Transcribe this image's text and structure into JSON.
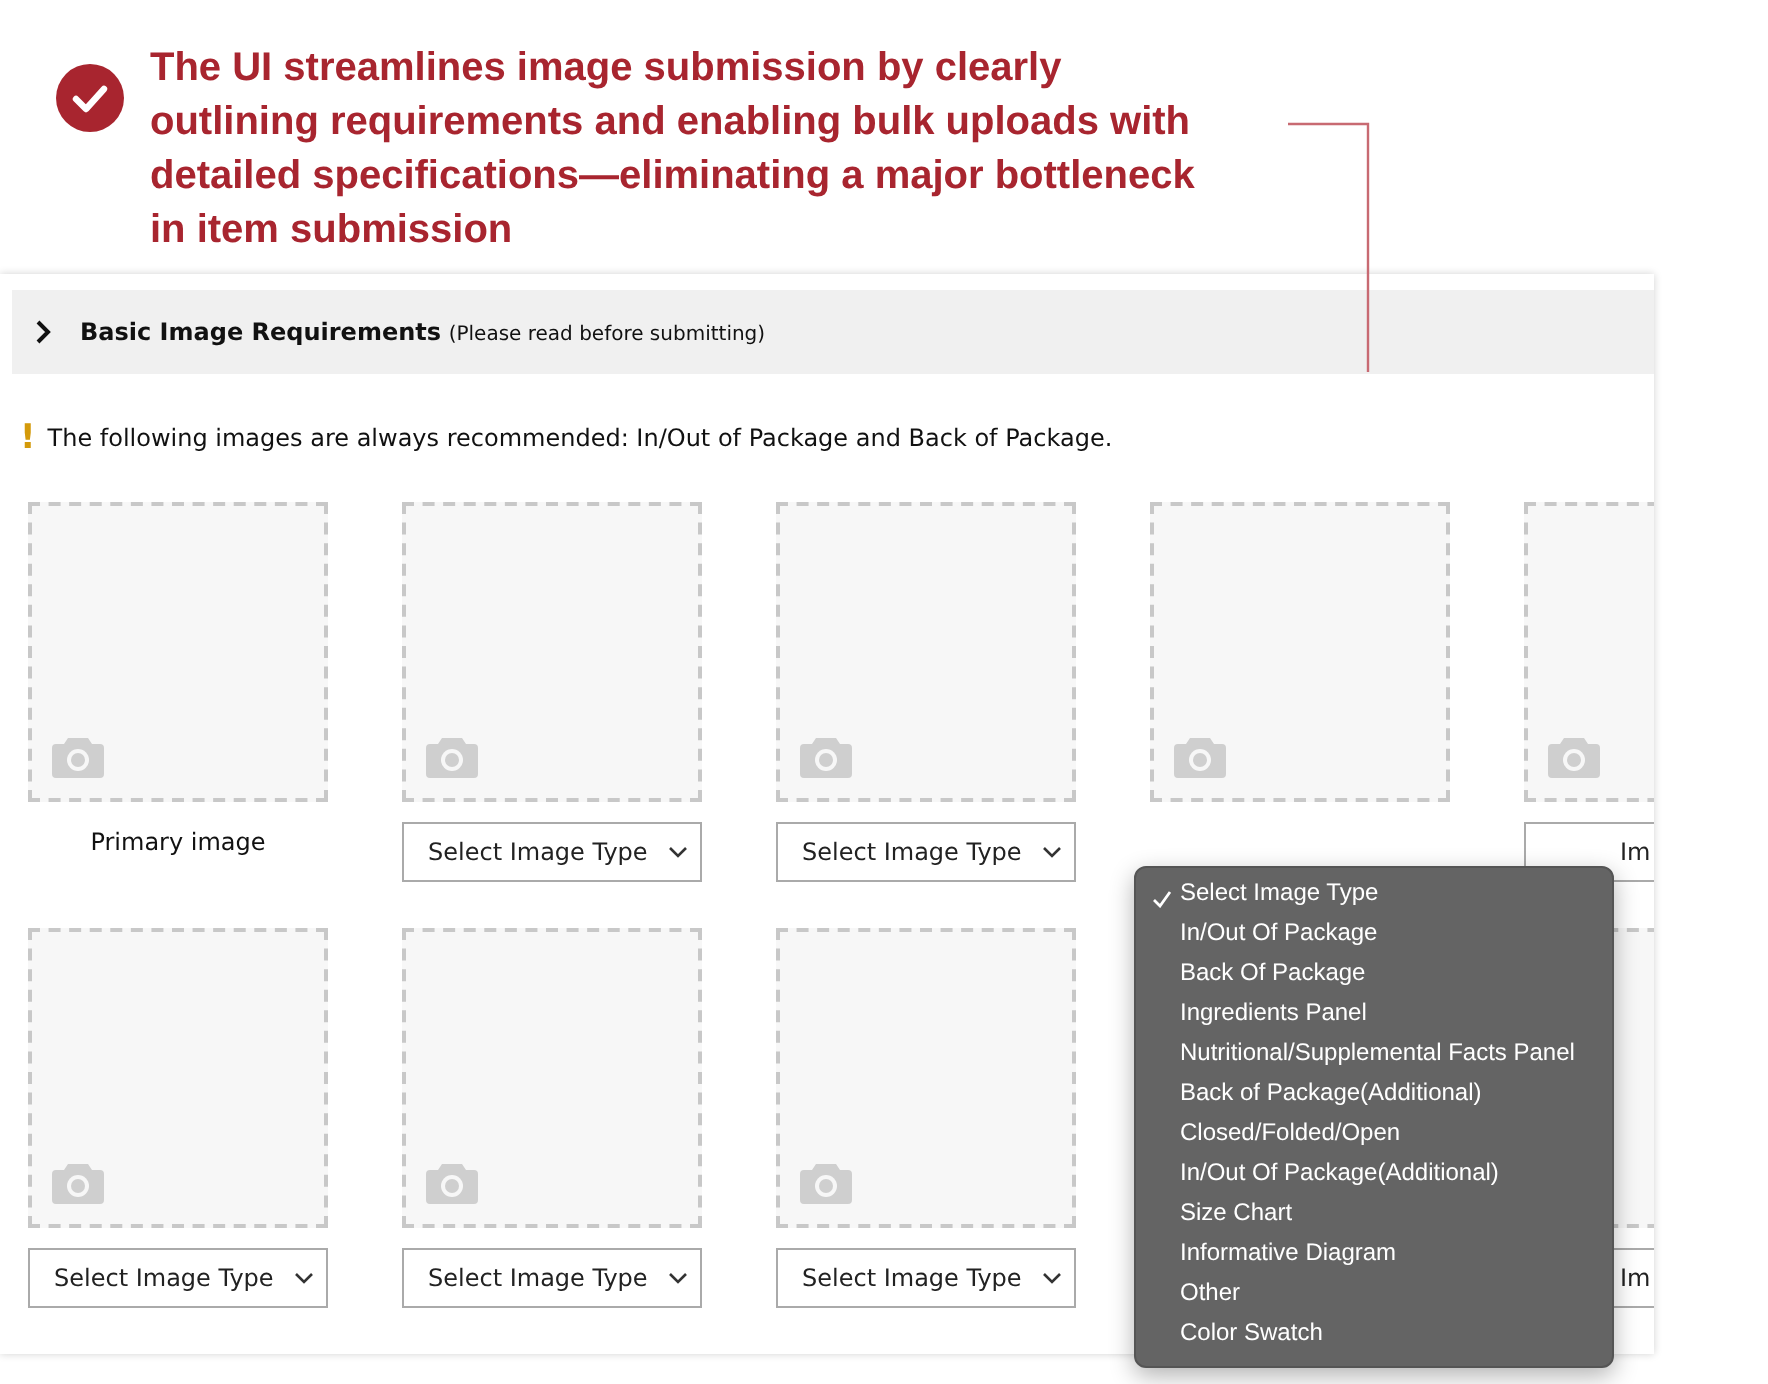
{
  "callout": {
    "text": "The UI streamlines image submission by clearly outlining requirements and enabling bulk uploads with detailed specifications—eliminating a major bottleneck in item submission"
  },
  "requirements": {
    "title": "Basic Image Requirements",
    "note": "(Please read before submitting)",
    "expanded": false
  },
  "warning": {
    "icon": "!",
    "text": "The following images are always recommended: In/Out of Package and Back of Package."
  },
  "image_rows": [
    [
      {
        "kind": "label",
        "text": "Primary image"
      },
      {
        "kind": "select",
        "text": "Select Image Type"
      },
      {
        "kind": "select",
        "text": "Select Image Type"
      },
      {
        "kind": "card-only"
      },
      {
        "kind": "covered",
        "text": "Im"
      }
    ],
    [
      {
        "kind": "select",
        "text": "Select Image Type"
      },
      {
        "kind": "select",
        "text": "Select Image Type"
      },
      {
        "kind": "select",
        "text": "Select Image Type"
      },
      {
        "kind": "hidden"
      },
      {
        "kind": "covered-blank",
        "text": "Im"
      }
    ]
  ],
  "dropdown_menu": [
    {
      "label": "Select Image Type",
      "selected": true
    },
    {
      "label": "In/Out Of Package",
      "selected": false
    },
    {
      "label": "Back Of Package",
      "selected": false
    },
    {
      "label": "Ingredients Panel",
      "selected": false
    },
    {
      "label": "Nutritional/Supplemental Facts Panel",
      "selected": false
    },
    {
      "label": "Back of Package(Additional)",
      "selected": false
    },
    {
      "label": "Closed/Folded/Open",
      "selected": false
    },
    {
      "label": "In/Out Of Package(Additional)",
      "selected": false
    },
    {
      "label": "Size Chart",
      "selected": false
    },
    {
      "label": "Informative Diagram",
      "selected": false
    },
    {
      "label": "Other",
      "selected": false
    },
    {
      "label": "Color Swatch",
      "selected": false
    }
  ]
}
